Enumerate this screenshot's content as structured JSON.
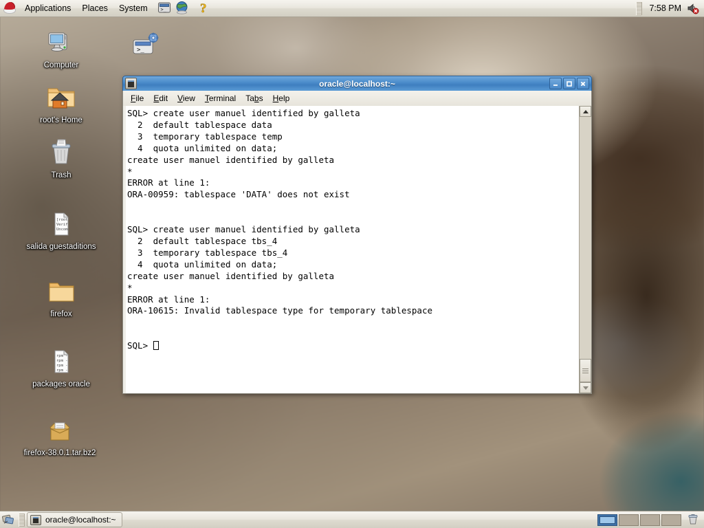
{
  "top_panel": {
    "logo_icon": "redhat-logo-icon",
    "menus": [
      {
        "label": "Applications",
        "name": "menu-applications"
      },
      {
        "label": "Places",
        "name": "menu-places"
      },
      {
        "label": "System",
        "name": "menu-system"
      }
    ],
    "launchers": [
      {
        "name": "terminal-launcher-icon",
        "icon": "terminal-icon"
      },
      {
        "name": "browser-launcher-icon",
        "icon": "globe-icon"
      },
      {
        "name": "help-launcher-icon",
        "icon": "question-mark-icon"
      }
    ],
    "clock": "7:58 PM",
    "volume_icon": "speaker-muted-icon"
  },
  "desktop": {
    "icons": [
      {
        "label": "Computer",
        "icon": "computer-icon",
        "name": "desktop-icon-computer"
      },
      {
        "label": "root's Home",
        "icon": "home-folder-icon",
        "name": "desktop-icon-roots-home"
      },
      {
        "label": "Trash",
        "icon": "trash-icon",
        "name": "desktop-icon-trash"
      },
      {
        "label": "salida guestaditions",
        "icon": "text-file-icon",
        "name": "desktop-icon-salida-guestaditions",
        "preview": [
          "[root",
          "Verif",
          "Uncom"
        ]
      },
      {
        "label": "firefox",
        "icon": "folder-icon",
        "name": "desktop-icon-firefox-folder"
      },
      {
        "label": "packages oracle",
        "icon": "text-file-icon",
        "name": "desktop-icon-packages-oracle",
        "preview": [
          "rpm -",
          "rpm -",
          "rpm -",
          "rpm -"
        ]
      },
      {
        "label": "firefox-38.0.1.tar.bz2",
        "icon": "archive-icon",
        "name": "desktop-icon-firefox-tarball"
      }
    ],
    "script_icon": {
      "name": "desktop-icon-script",
      "icon": "terminal-script-icon",
      "label": ""
    }
  },
  "terminal": {
    "title": "oracle@localhost:~",
    "window_icon": "terminal-icon",
    "titlebar_buttons": [
      {
        "name": "minimize-button",
        "icon": "minimize-icon",
        "glyph": "_"
      },
      {
        "name": "maximize-button",
        "icon": "maximize-icon",
        "glyph": "□"
      },
      {
        "name": "close-button",
        "icon": "close-icon",
        "glyph": "✖"
      }
    ],
    "menubar": [
      {
        "label": "File",
        "mnemonic": "F",
        "name": "menu-file"
      },
      {
        "label": "Edit",
        "mnemonic": "E",
        "name": "menu-edit"
      },
      {
        "label": "View",
        "mnemonic": "V",
        "name": "menu-view"
      },
      {
        "label": "Terminal",
        "mnemonic": "T",
        "name": "menu-terminal"
      },
      {
        "label": "Tabs",
        "mnemonic": "b",
        "name": "menu-tabs"
      },
      {
        "label": "Help",
        "mnemonic": "H",
        "name": "menu-help"
      }
    ],
    "content": "SQL> create user manuel identified by galleta\n  2  default tablespace data\n  3  temporary tablespace temp\n  4  quota unlimited on data;\ncreate user manuel identified by galleta\n*\nERROR at line 1:\nORA-00959: tablespace 'DATA' does not exist\n\n\nSQL> create user manuel identified by galleta\n  2  default tablespace tbs_4\n  3  temporary tablespace tbs_4\n  4  quota unlimited on data;\ncreate user manuel identified by galleta\n*\nERROR at line 1:\nORA-10615: Invalid tablespace type for temporary tablespace\n\n\n",
    "prompt": "SQL> ",
    "scrollbar": {
      "up_icon": "scroll-up-arrow-icon",
      "down_icon": "scroll-down-arrow-icon"
    }
  },
  "bottom_panel": {
    "show_desktop_icon": "show-desktop-icon",
    "tasks": [
      {
        "label": "oracle@localhost:~",
        "icon": "terminal-icon",
        "name": "taskbar-button-terminal",
        "active": true
      }
    ],
    "workspaces": [
      {
        "name": "workspace-1",
        "active": true
      },
      {
        "name": "workspace-2",
        "active": false
      },
      {
        "name": "workspace-3",
        "active": false
      },
      {
        "name": "workspace-4",
        "active": false
      }
    ],
    "trash_applet_icon": "trash-applet-icon"
  },
  "colors": {
    "panel_bg": "#e9e6dd",
    "titlebar_active": "#4f8fcc",
    "terminal_bg": "#ffffff",
    "terminal_fg": "#000000",
    "workspace_active": "#3f72a8"
  }
}
